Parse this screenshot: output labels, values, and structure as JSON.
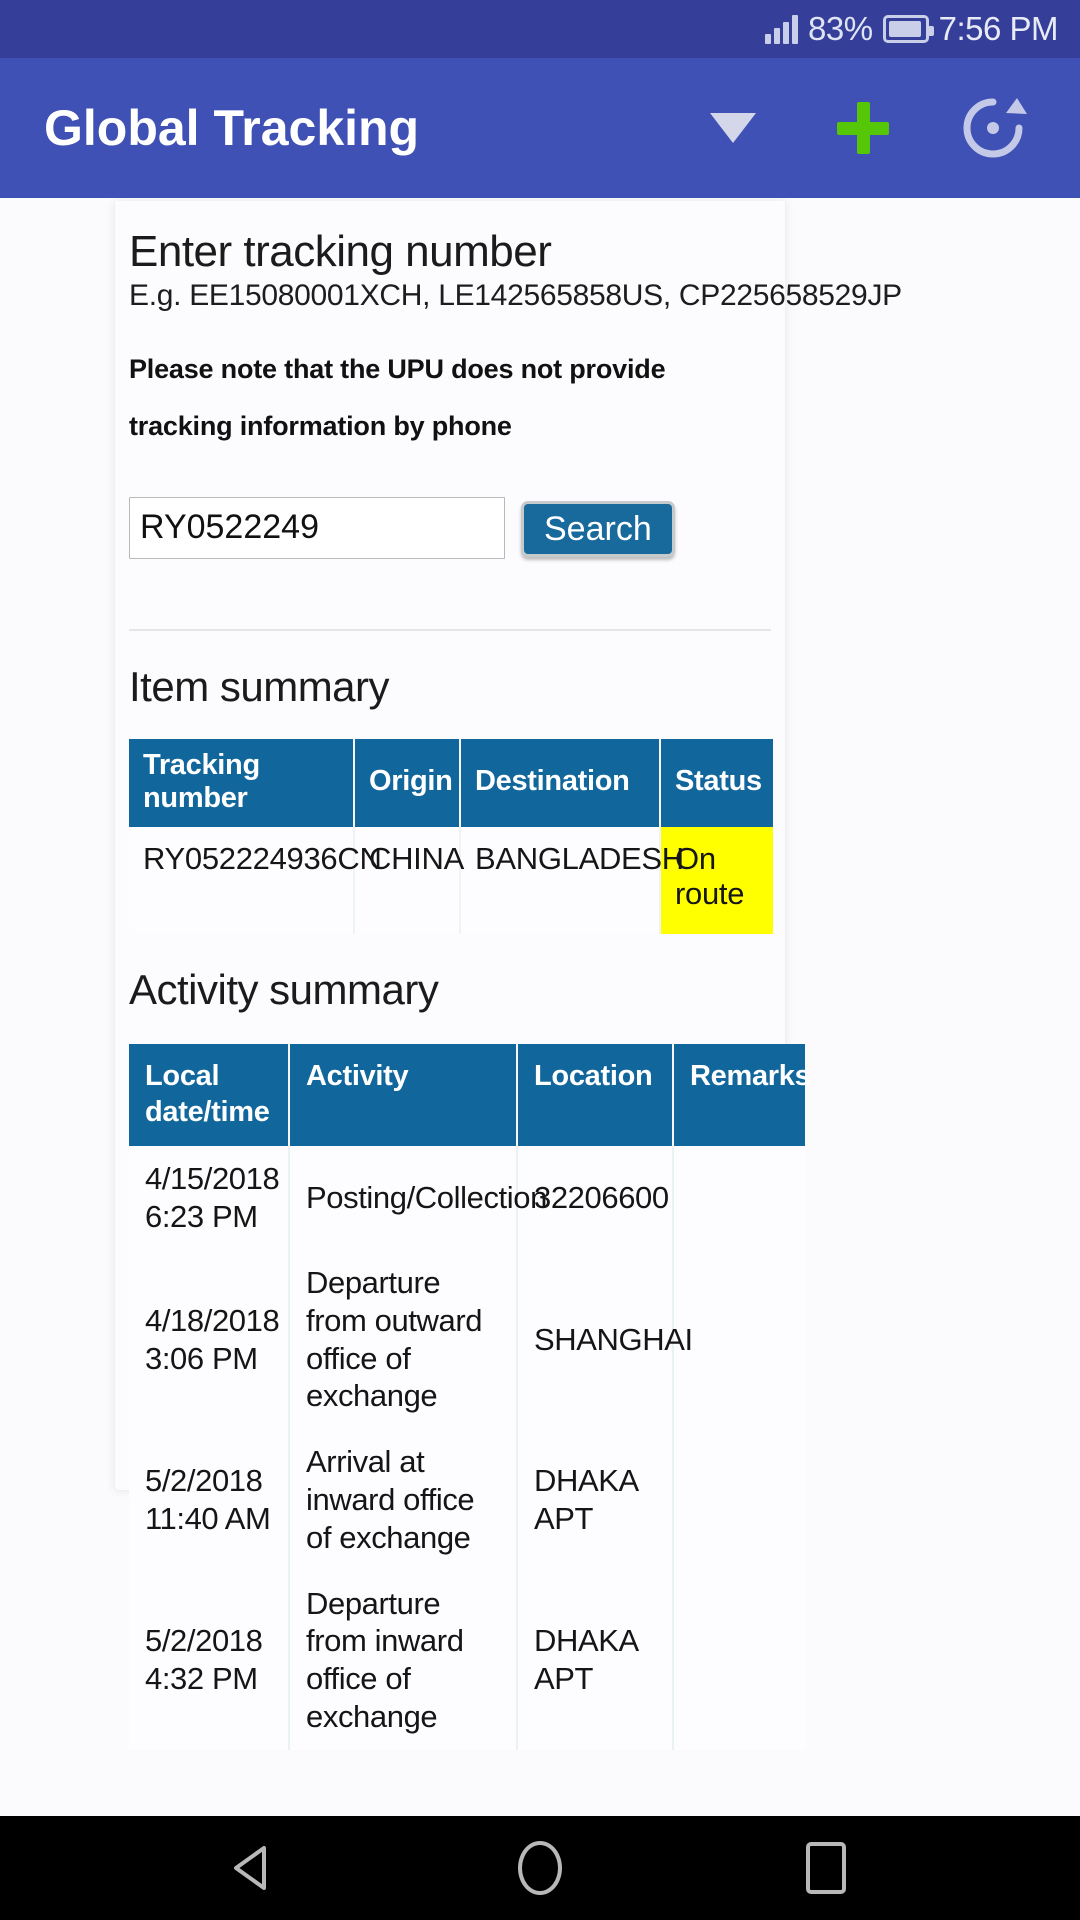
{
  "status_bar": {
    "battery_percent": "83%",
    "time": "7:56 PM",
    "icons": [
      "signal-bars-icon",
      "battery-icon"
    ]
  },
  "app_bar": {
    "title": "Global Tracking",
    "actions": [
      {
        "name": "dropdown-caret-icon",
        "label": ""
      },
      {
        "name": "add-icon",
        "label": ""
      },
      {
        "name": "refresh-icon",
        "label": ""
      }
    ]
  },
  "search_card": {
    "heading": "Enter tracking number",
    "examples": "E.g. EE15080001XCH, LE142565858US, CP225658529JP",
    "note": "Please note that the UPU does not provide tracking information by phone",
    "input_value": "RY0522249",
    "input_placeholder": "",
    "search_button": "Search"
  },
  "item_summary": {
    "heading": "Item summary",
    "columns": [
      "Tracking number",
      "Origin",
      "Destination",
      "Status"
    ],
    "rows": [
      {
        "tracking_number": "RY052224936CN",
        "origin": "CHINA",
        "destination": "BANGLADESH",
        "status": "On route",
        "status_color": "#ffff00"
      }
    ]
  },
  "activity_summary": {
    "heading": "Activity summary",
    "columns": [
      "Local date/time",
      "Activity",
      "Location",
      "Remarks"
    ],
    "rows": [
      {
        "datetime": "4/15/2018 6:23 PM",
        "activity": "Posting/Collection",
        "location": "32206600",
        "remarks": ""
      },
      {
        "datetime": "4/18/2018 3:06 PM",
        "activity": "Departure from outward office of exchange",
        "location": "SHANGHAI",
        "remarks": ""
      },
      {
        "datetime": "5/2/2018 11:40 AM",
        "activity": "Arrival at inward office of exchange",
        "location": "DHAKA APT",
        "remarks": ""
      },
      {
        "datetime": "5/2/2018 4:32 PM",
        "activity": "Departure from inward office of exchange",
        "location": "DHAKA APT",
        "remarks": ""
      }
    ]
  },
  "nav_bar": {
    "buttons": [
      "back-icon",
      "home-icon",
      "recents-icon"
    ]
  },
  "colors": {
    "status_bar": "#353f99",
    "app_bar": "#3f51b5",
    "table_header": "#11679c",
    "button": "#18699c",
    "accent_green": "#56c706",
    "highlight": "#ffff00"
  }
}
